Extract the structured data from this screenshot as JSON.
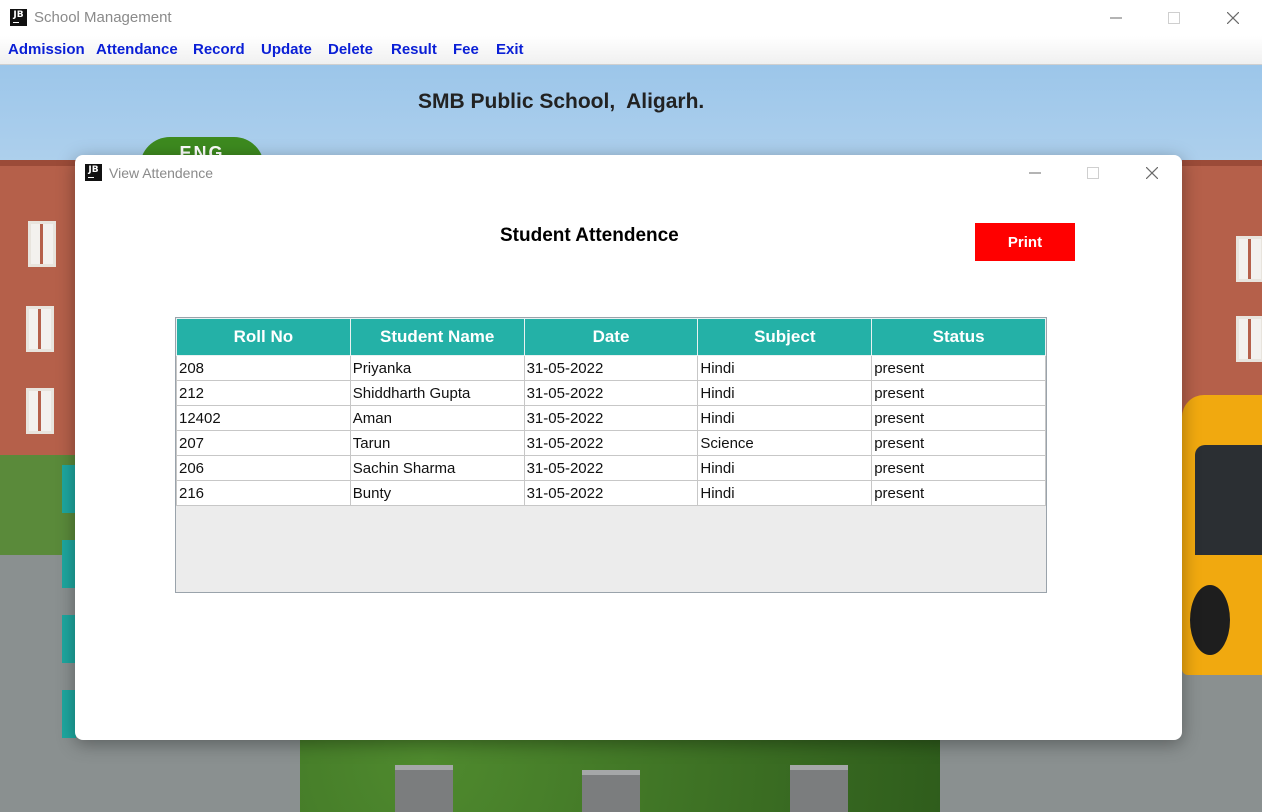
{
  "main_window": {
    "icon_text": "JB",
    "title": "School Management",
    "menu": [
      "Admission",
      "Attendance",
      "Record",
      "Update",
      "Delete",
      "Result",
      "Fee",
      "Exit"
    ]
  },
  "background": {
    "school_name": "SMB Public School,  Aligarh.",
    "logo_text": "ENG"
  },
  "dialog": {
    "icon_text": "JB",
    "title": "View Attendence",
    "heading": "Student Attendence",
    "print_label": "Print",
    "table": {
      "columns": [
        "Roll No",
        "Student Name",
        "Date",
        "Subject",
        "Status"
      ],
      "rows": [
        [
          "208",
          "Priyanka",
          "31-05-2022",
          "Hindi",
          "present"
        ],
        [
          "212",
          "Shiddharth Gupta",
          "31-05-2022",
          "Hindi",
          "present"
        ],
        [
          "12402",
          "Aman",
          "31-05-2022",
          "Hindi",
          "present"
        ],
        [
          "207",
          "Tarun",
          "31-05-2022",
          "Science",
          "present"
        ],
        [
          "206",
          "Sachin Sharma",
          "31-05-2022",
          "Hindi",
          "present"
        ],
        [
          "216",
          "Bunty",
          "31-05-2022",
          "Hindi",
          "present"
        ]
      ]
    }
  },
  "colors": {
    "menu_text": "#0a1fd6",
    "table_header": "#24b1a7",
    "print_button": "#ff0000"
  }
}
